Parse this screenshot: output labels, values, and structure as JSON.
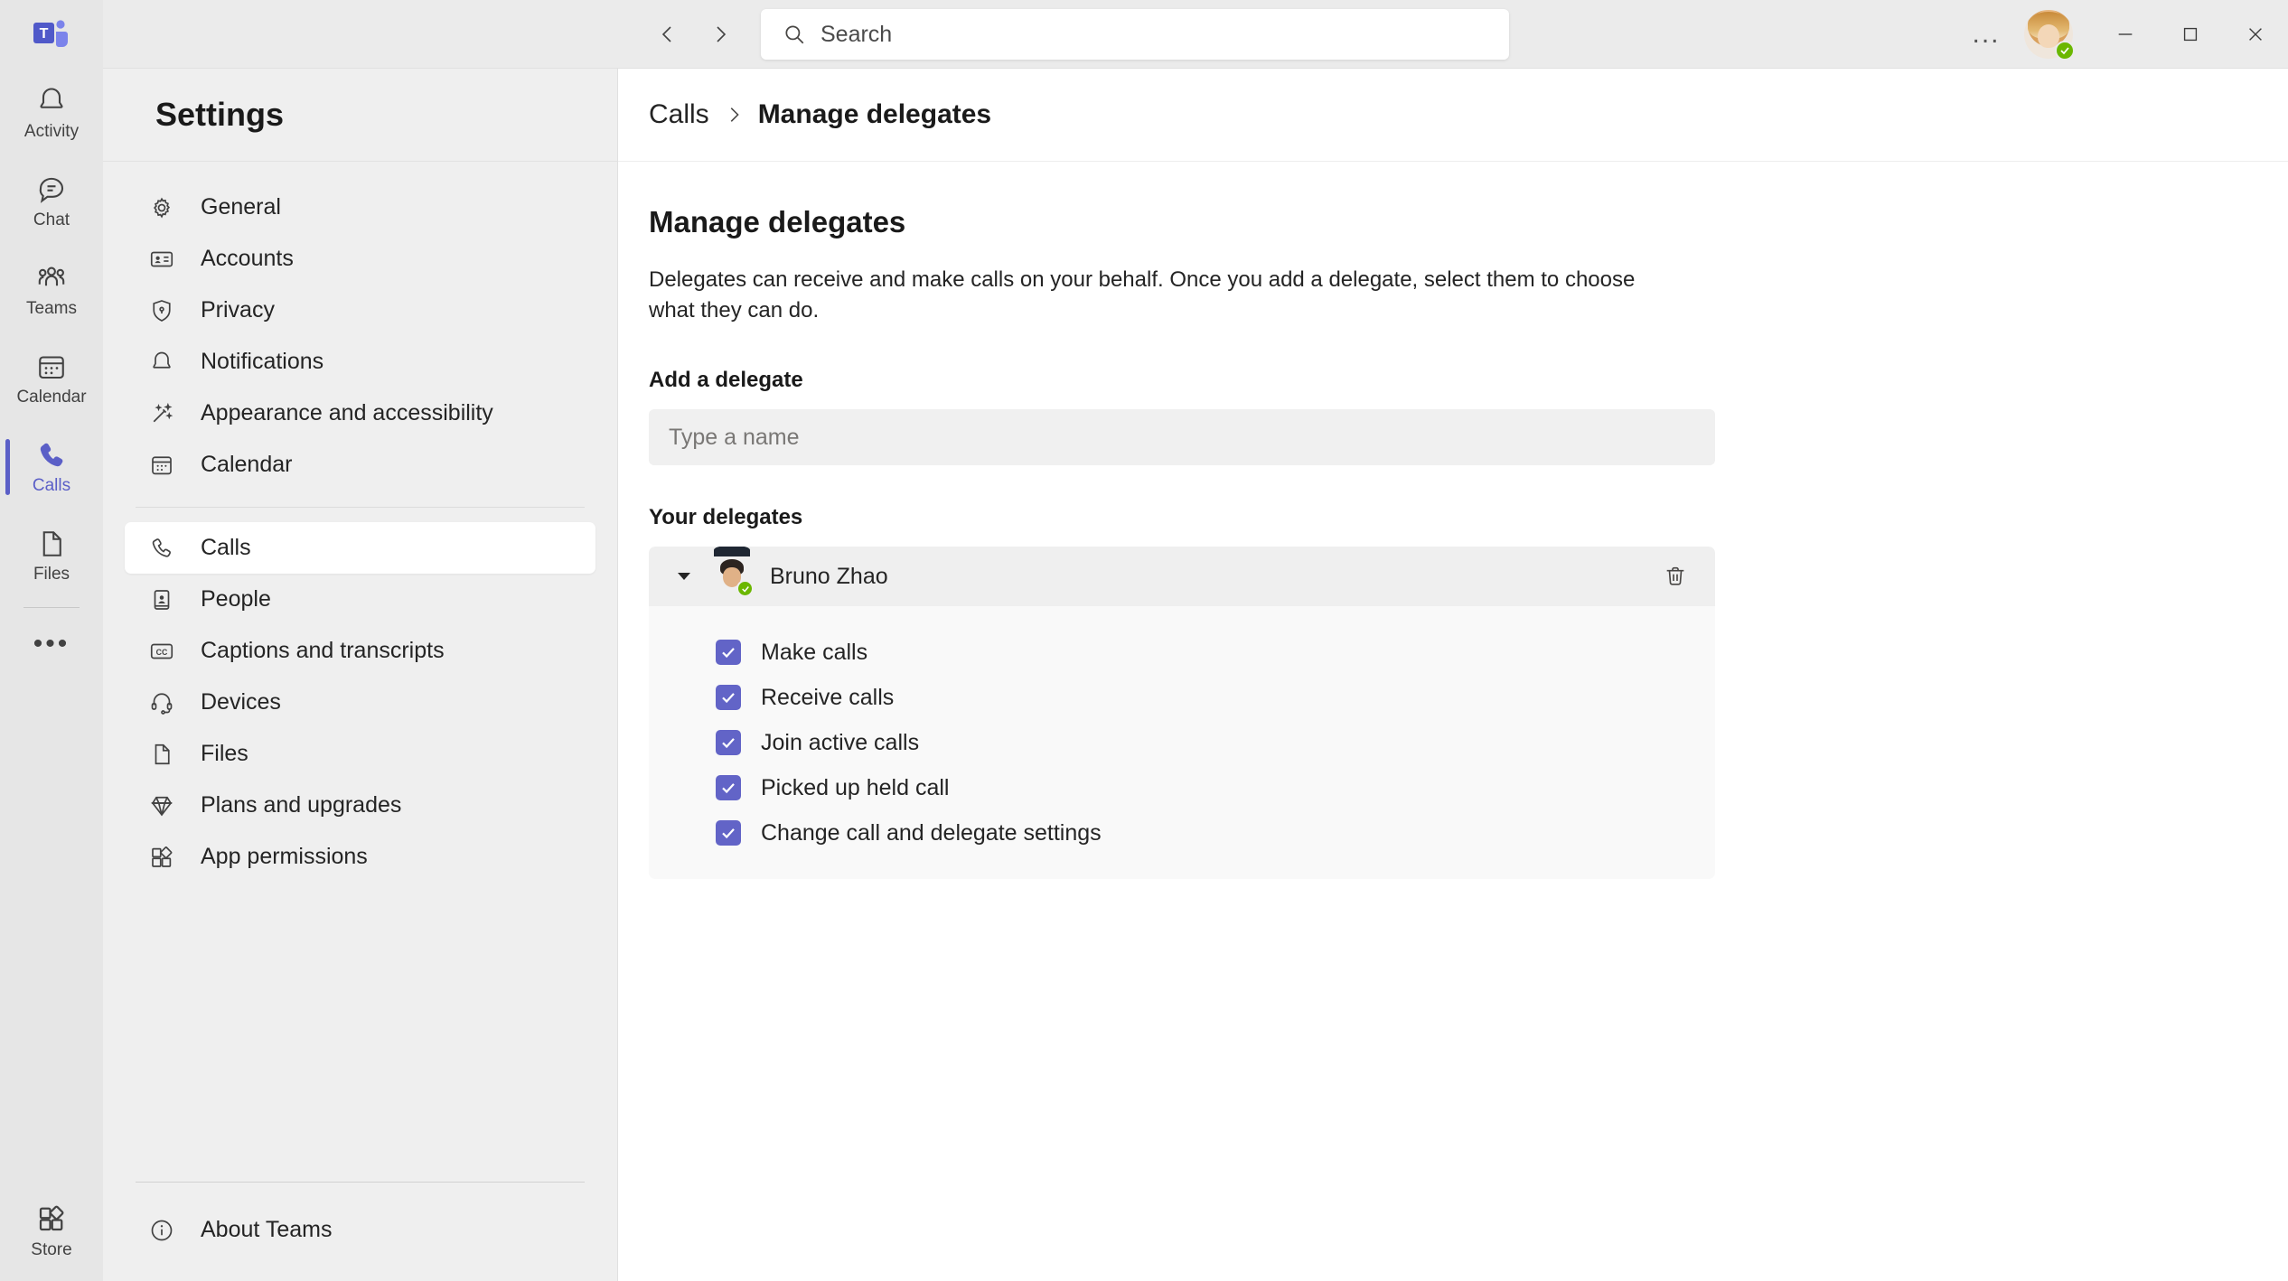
{
  "titlebar": {
    "logo_name": "microsoft-teams-logo",
    "back_label": "Back",
    "forward_label": "Forward",
    "search_placeholder": "Search",
    "more_label": "...",
    "minimize_label": "Minimize",
    "maximize_label": "Maximize",
    "close_label": "Close",
    "user_presence": "available"
  },
  "rail": {
    "items": [
      {
        "label": "Activity",
        "icon": "bell-icon",
        "active": false
      },
      {
        "label": "Chat",
        "icon": "chat-icon",
        "active": false
      },
      {
        "label": "Teams",
        "icon": "teams-icon",
        "active": false
      },
      {
        "label": "Calendar",
        "icon": "calendar-icon",
        "active": false
      },
      {
        "label": "Calls",
        "icon": "phone-icon",
        "active": true
      },
      {
        "label": "Files",
        "icon": "file-icon",
        "active": false
      }
    ],
    "more_label": "•••",
    "store": {
      "label": "Store",
      "icon": "store-icon"
    }
  },
  "settings": {
    "title": "Settings",
    "items_top": [
      {
        "label": "General",
        "icon": "gear-icon"
      },
      {
        "label": "Accounts",
        "icon": "id-card-icon"
      },
      {
        "label": "Privacy",
        "icon": "shield-lock-icon"
      },
      {
        "label": "Notifications",
        "icon": "bell-icon"
      },
      {
        "label": "Appearance and accessibility",
        "icon": "magic-wand-icon"
      },
      {
        "label": "Calendar",
        "icon": "calendar-icon"
      }
    ],
    "items_bottom": [
      {
        "label": "Calls",
        "icon": "phone-icon",
        "active": true
      },
      {
        "label": "People",
        "icon": "contact-book-icon",
        "active": false
      },
      {
        "label": "Captions and transcripts",
        "icon": "closed-caption-icon",
        "active": false
      },
      {
        "label": "Devices",
        "icon": "headset-icon",
        "active": false
      },
      {
        "label": "Files",
        "icon": "file-icon",
        "active": false
      },
      {
        "label": "Plans and upgrades",
        "icon": "diamond-icon",
        "active": false
      },
      {
        "label": "App permissions",
        "icon": "apps-icon",
        "active": false
      }
    ],
    "about": {
      "label": "About Teams",
      "icon": "info-icon"
    }
  },
  "breadcrumb": {
    "parent": "Calls",
    "separator_icon": "chevron-right-icon",
    "current": "Manage delegates"
  },
  "main": {
    "page_title": "Manage delegates",
    "description": "Delegates can receive and make calls on your behalf. Once you add a delegate, select them to choose what they can do.",
    "add_delegate_label": "Add a delegate",
    "name_input_value": "",
    "name_input_placeholder": "Type a name",
    "your_delegates_label": "Your delegates",
    "delegates": [
      {
        "name": "Bruno Zhao",
        "presence": "available",
        "expanded": true,
        "disclosure_icon": "chevron-down-icon",
        "delete_icon": "trash-icon",
        "permissions": [
          {
            "label": "Make calls",
            "checked": true
          },
          {
            "label": "Receive calls",
            "checked": true
          },
          {
            "label": "Join active calls",
            "checked": true
          },
          {
            "label": "Picked up held call",
            "checked": true
          },
          {
            "label": "Change call and delegate settings",
            "checked": true
          }
        ]
      }
    ]
  },
  "colors": {
    "accent": "#6264c7",
    "rail_active": "#5b5fc7",
    "presence_available": "#6bb700",
    "chrome_bg": "#ebebeb",
    "settings_bg": "#efefef",
    "panel_bg": "#f9f9f9"
  }
}
